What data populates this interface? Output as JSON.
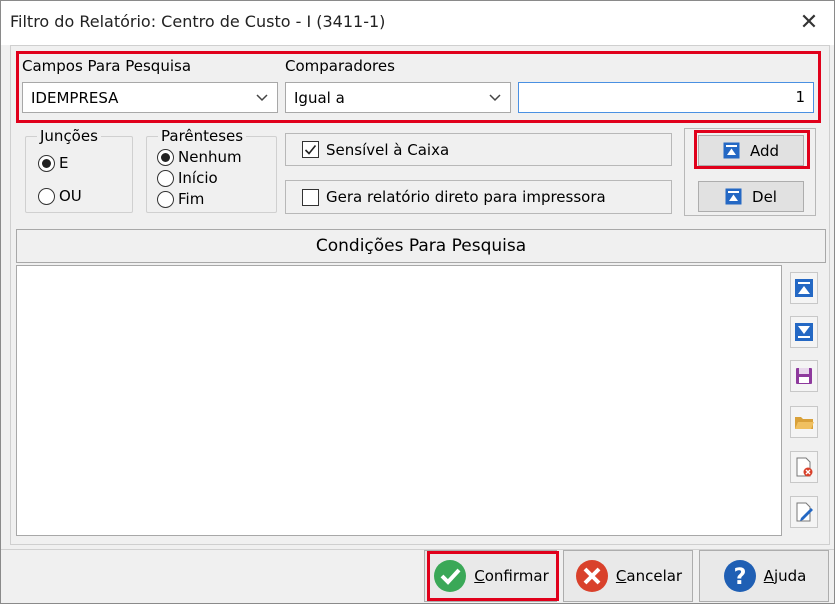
{
  "window": {
    "title": "Filtro do Relatório: Centro de Custo - I (3411-1)",
    "close_glyph": "✕"
  },
  "search": {
    "fields_label": "Campos Para Pesquisa",
    "field_value": "IDEMPRESA",
    "comparators_label": "Comparadores",
    "comparator_value": "Igual a",
    "input_value": "1"
  },
  "junctions": {
    "title": "Junções",
    "options": [
      "E",
      "OU"
    ],
    "selected": "E"
  },
  "parentheses": {
    "title": "Parênteses",
    "options": [
      "Nenhum",
      "Início",
      "Fim"
    ],
    "selected": "Nenhum"
  },
  "options": {
    "case_sensitive_label": "Sensível à Caixa",
    "case_sensitive_checked": true,
    "direct_print_label": "Gera relatório direto para impressora",
    "direct_print_checked": false
  },
  "buttons": {
    "add": "Add",
    "del": "Del"
  },
  "conditions": {
    "header": "Condições Para Pesquisa"
  },
  "side_tools": [
    "move-top-icon",
    "move-bottom-icon",
    "save-icon",
    "open-folder-icon",
    "delete-file-icon",
    "edit-file-icon"
  ],
  "footer": {
    "confirm_first": "C",
    "confirm_rest": "onfirmar",
    "cancel_first": "C",
    "cancel_rest": "ancelar",
    "help_first": "A",
    "help_rest": "juda"
  },
  "colors": {
    "highlight": "#e0001b",
    "confirm": "#3aa857",
    "cancel": "#d9412b",
    "help": "#1f5fb4",
    "tool_blue": "#2468c4"
  }
}
